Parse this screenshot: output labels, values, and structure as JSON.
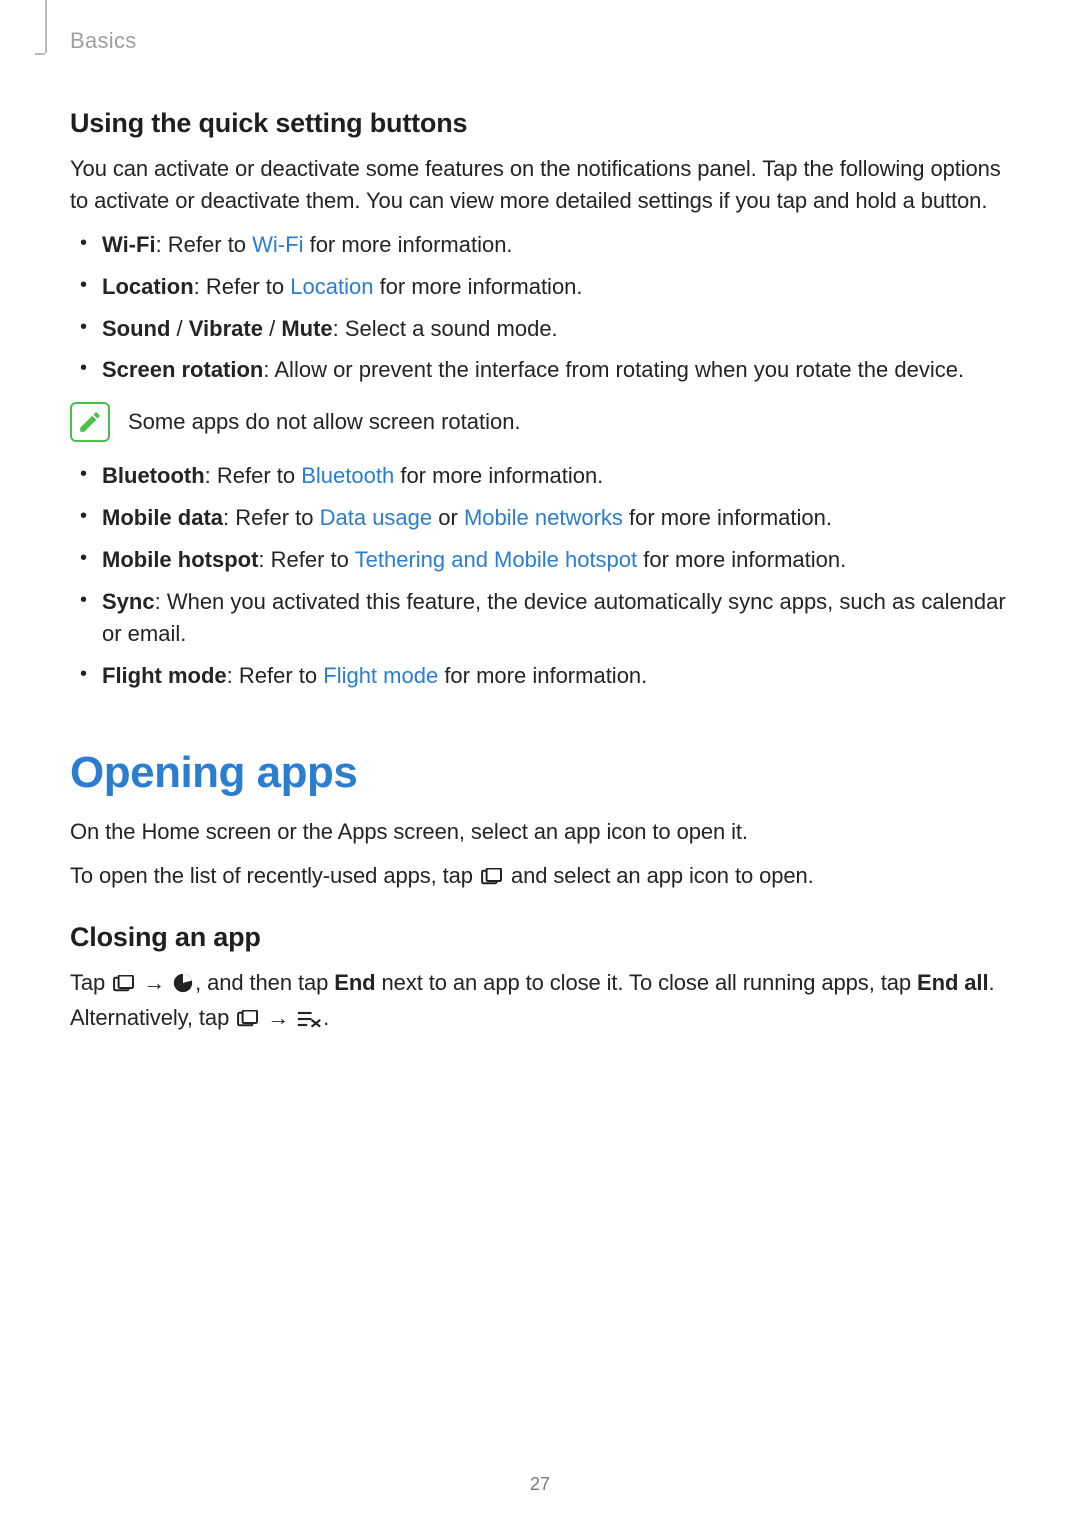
{
  "header": {
    "chapter": "Basics"
  },
  "section1": {
    "heading": "Using the quick setting buttons",
    "intro": "You can activate or deactivate some features on the notifications panel. Tap the following options to activate or deactivate them. You can view more detailed settings if you tap and hold a button."
  },
  "bullets_a": {
    "wifi": {
      "label": "Wi-Fi",
      "pre": ": Refer to ",
      "link": "Wi-Fi",
      "post": " for more information."
    },
    "location": {
      "label": "Location",
      "pre": ": Refer to ",
      "link": "Location",
      "post": " for more information."
    },
    "sound": {
      "label": "Sound",
      "sep1": " / ",
      "label2": "Vibrate",
      "sep2": " / ",
      "label3": "Mute",
      "post": ": Select a sound mode."
    },
    "rotation": {
      "label": "Screen rotation",
      "post": ": Allow or prevent the interface from rotating when you rotate the device."
    }
  },
  "note": {
    "text": "Some apps do not allow screen rotation."
  },
  "bullets_b": {
    "bluetooth": {
      "label": "Bluetooth",
      "pre": ": Refer to ",
      "link": "Bluetooth",
      "post": " for more information."
    },
    "mobiledata": {
      "label": "Mobile data",
      "pre": ": Refer to ",
      "link1": "Data usage",
      "mid": " or ",
      "link2": "Mobile networks",
      "post": " for more information."
    },
    "hotspot": {
      "label": "Mobile hotspot",
      "pre": ": Refer to ",
      "link": "Tethering and Mobile hotspot",
      "post": " for more information."
    },
    "sync": {
      "label": "Sync",
      "post": ": When you activated this feature, the device automatically sync apps, such as calendar or email."
    },
    "flight": {
      "label": "Flight mode",
      "pre": ": Refer to ",
      "link": "Flight mode",
      "post": " for more information."
    }
  },
  "section2": {
    "heading": "Opening apps",
    "p1": "On the Home screen or the Apps screen, select an app icon to open it.",
    "p2_pre": "To open the list of recently-used apps, tap ",
    "p2_post": " and select an app icon to open."
  },
  "section3": {
    "heading": "Closing an app",
    "tap": "Tap ",
    "arrow": "→",
    "mid1": ", and then tap ",
    "end": "End",
    "mid2": " next to an app to close it. To close all running apps, tap ",
    "endall": "End all",
    "mid3": ". Alternatively, tap ",
    "period": "."
  },
  "page_number": "27",
  "colors": {
    "link": "#2a7dd1",
    "note_border": "#4abf4a"
  }
}
